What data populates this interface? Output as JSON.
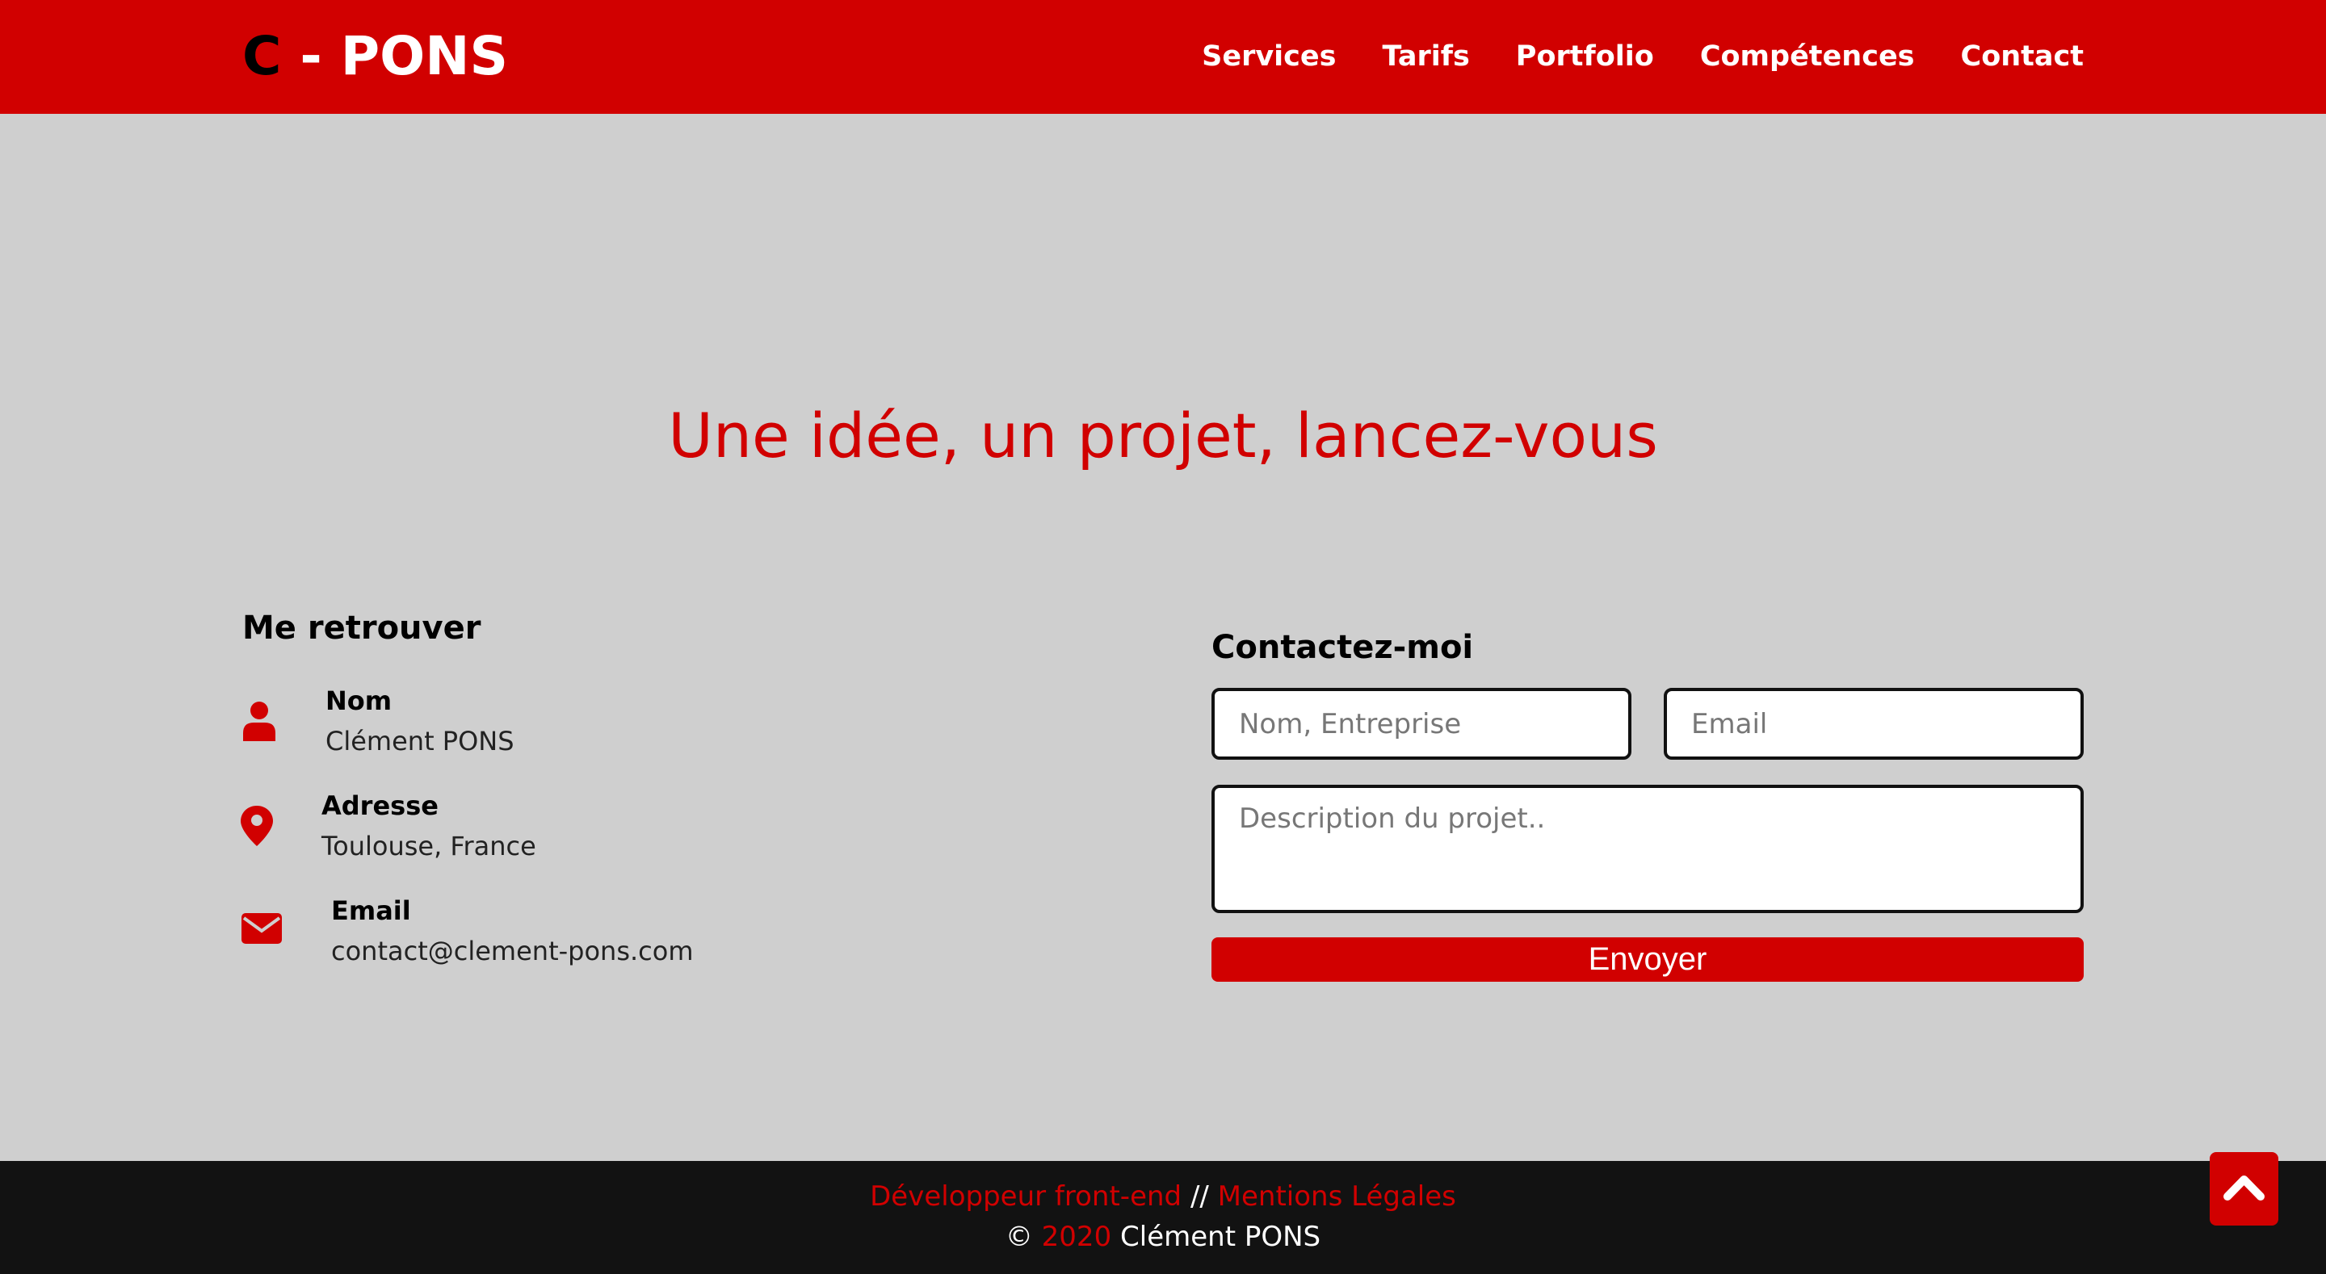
{
  "brand": {
    "logo_c": "C",
    "logo_rest": " - PONS"
  },
  "nav": {
    "items": [
      "Services",
      "Tarifs",
      "Portfolio",
      "Compétences",
      "Contact"
    ]
  },
  "hero": {
    "title": "Une idée, un projet, lancez-vous"
  },
  "find_me": {
    "title": "Me retrouver",
    "items": [
      {
        "icon": "user-icon",
        "label": "Nom",
        "value": "Clément PONS"
      },
      {
        "icon": "map-marker-icon",
        "label": "Adresse",
        "value": "Toulouse, France"
      },
      {
        "icon": "envelope-icon",
        "label": "Email",
        "value": "contact@clement-pons.com"
      }
    ]
  },
  "contact_form": {
    "title": "Contactez-moi",
    "name_placeholder": "Nom, Entreprise",
    "email_placeholder": "Email",
    "description_placeholder": "Description du projet..",
    "submit_label": "Envoyer"
  },
  "footer": {
    "role_link": "Développeur front-end",
    "separator": "//",
    "legal_link": "Mentions Légales",
    "copyright_symbol": "©",
    "year": "2020",
    "owner": "Clément PONS"
  },
  "colors": {
    "accent": "#d10000",
    "background": "#cfcfcf",
    "footer": "#121212"
  }
}
